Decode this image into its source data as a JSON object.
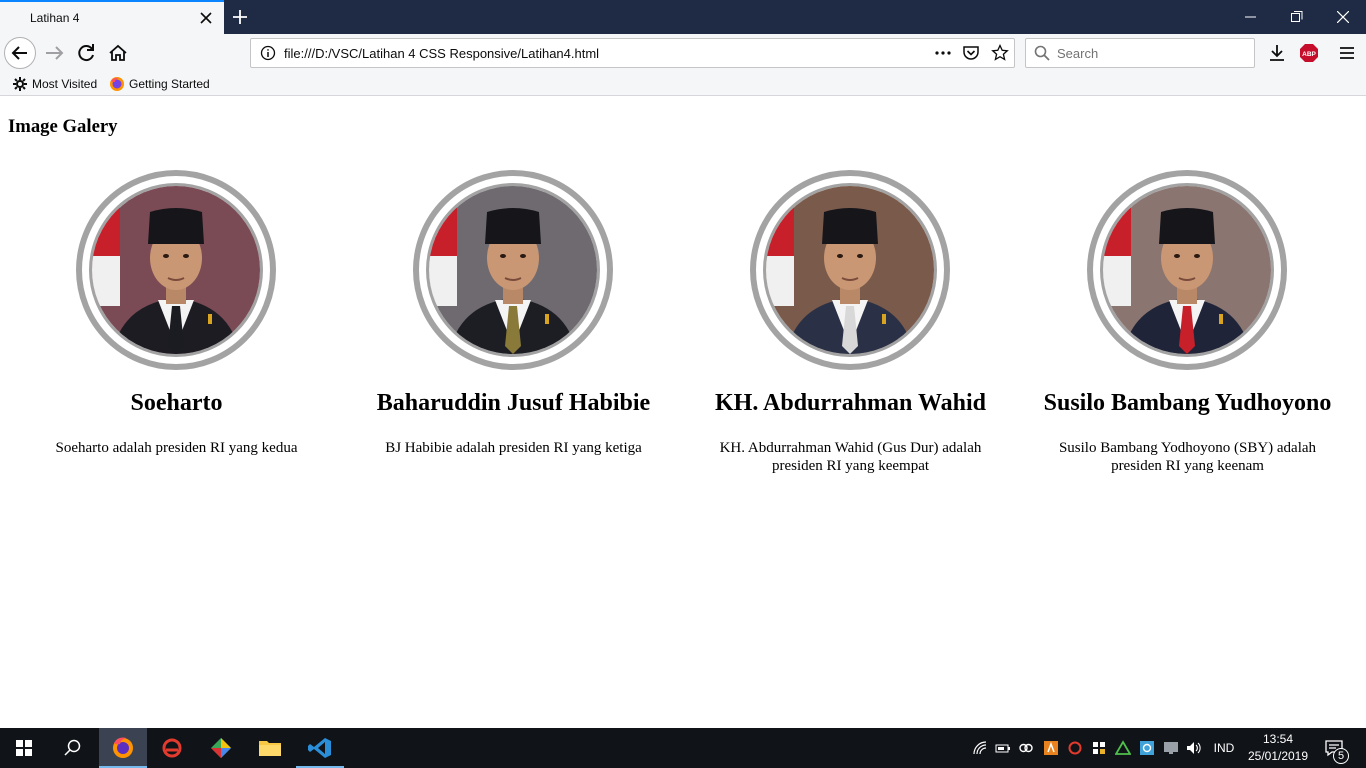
{
  "browser": {
    "tab_title": "Latihan 4",
    "url": "file:///D:/VSC/Latihan 4 CSS Responsive/Latihan4.html",
    "search_placeholder": "Search",
    "bookmarks": [
      "Most Visited",
      "Getting Started"
    ]
  },
  "page": {
    "title": "Image Galery",
    "presidents": [
      {
        "name": "Soeharto",
        "description": "Soeharto adalah presiden RI yang kedua",
        "tie_color": "#1b1b22",
        "suit_color": "#1c1c22",
        "bg_color": "#7a4a55"
      },
      {
        "name": "Baharuddin Jusuf Habibie",
        "description": "BJ Habibie adalah presiden RI yang ketiga",
        "tie_color": "#8a7a3a",
        "suit_color": "#1d1e24",
        "bg_color": "#6e6a70"
      },
      {
        "name": "KH. Abdurrahman Wahid",
        "description": "KH. Abdurrahman Wahid (Gus Dur) adalah presiden RI yang keempat",
        "tie_color": "#d8d8d8",
        "suit_color": "#2a3146",
        "bg_color": "#7a5a4a"
      },
      {
        "name": "Susilo Bambang Yudhoyono",
        "description": "Susilo Bambang Yodhoyono (SBY) adalah presiden RI yang keenam",
        "tie_color": "#c8202a",
        "suit_color": "#1f2438",
        "bg_color": "#8a7570"
      }
    ]
  },
  "taskbar": {
    "language": "IND",
    "time": "13:54",
    "date": "25/01/2019",
    "notification_count": "5"
  },
  "colors": {
    "tabbar": "#1f2a44",
    "accent": "#0a84ff",
    "portrait_ring": "#a3a3a3"
  }
}
